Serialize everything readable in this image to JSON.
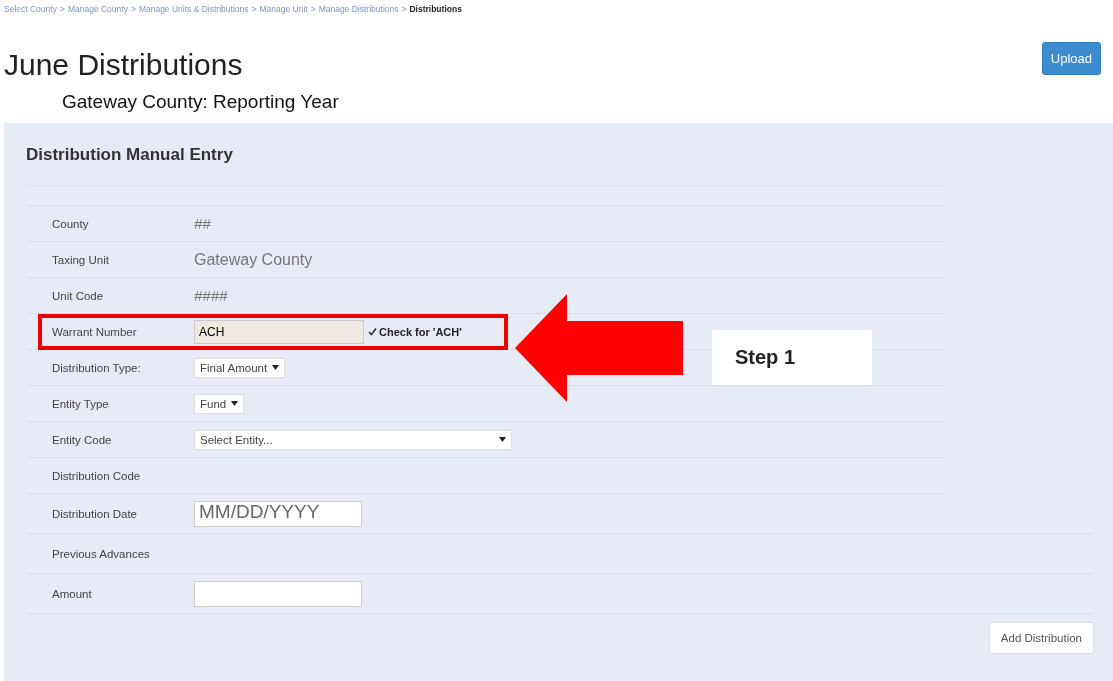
{
  "breadcrumb": {
    "separator": ">",
    "items": [
      {
        "label": "Select County",
        "selected": false
      },
      {
        "label": "Manage County",
        "selected": false
      },
      {
        "label": "Manage Units & Distributions",
        "selected": false
      },
      {
        "label": "Manage Unit",
        "selected": false
      },
      {
        "label": "Manage Distributions",
        "selected": false
      },
      {
        "label": "Distributions",
        "selected": true
      }
    ]
  },
  "title": "June Distributions",
  "subtitle": "Gateway County: Reporting Year",
  "upload_button": "Upload",
  "panel": {
    "heading": "Distribution Manual Entry",
    "rows": [
      {
        "label": "County",
        "kind": "text",
        "value": "##",
        "highlighted": false
      },
      {
        "label": "Taxing Unit",
        "kind": "text",
        "value": "Gateway County",
        "highlighted": false
      },
      {
        "label": "Unit Code",
        "kind": "text",
        "value": "####",
        "highlighted": false
      },
      {
        "label": "Warrant Number",
        "kind": "input_check",
        "value": "ACH",
        "check_label": "Check for 'ACH'",
        "checked": true,
        "highlighted": true
      },
      {
        "label": "Distribution Type:",
        "kind": "select",
        "value": "Final Amount",
        "highlighted": false
      },
      {
        "label": "Entity Type",
        "kind": "select",
        "value": "Fund",
        "highlighted": false
      },
      {
        "label": "Entity Code",
        "kind": "select_wide",
        "value": "Select Entity...",
        "highlighted": false
      },
      {
        "label": "Distribution Code",
        "kind": "none",
        "highlighted": false
      },
      {
        "label": "Distribution Date",
        "kind": "input",
        "placeholder": "MM/DD/YYYY",
        "highlighted": false
      },
      {
        "label": "Previous Advances",
        "kind": "none",
        "highlighted": false
      },
      {
        "label": "Amount",
        "kind": "input",
        "highlighted": false
      }
    ],
    "add_button": "Add Distribution"
  },
  "callout": {
    "text": "Step 1"
  }
}
